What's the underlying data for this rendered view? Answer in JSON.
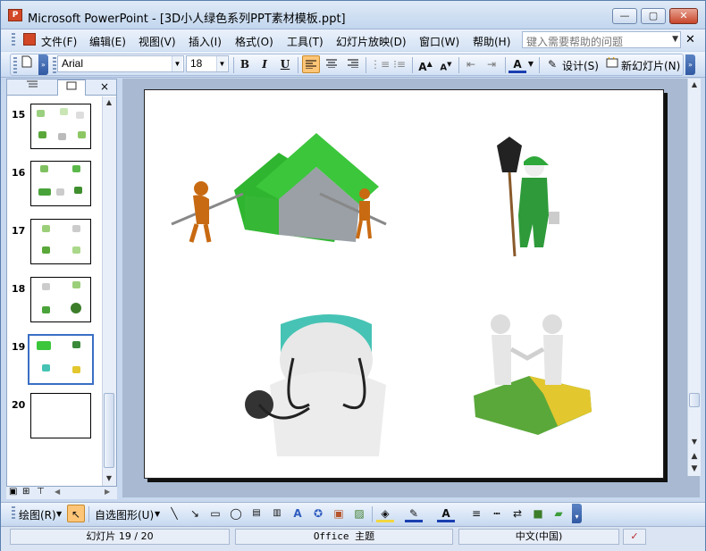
{
  "window": {
    "app_icon": "P",
    "title": "Microsoft PowerPoint - [3D小人绿色系列PPT素材模板.ppt]",
    "minimize": "—",
    "maximize": "▢",
    "close": "✕"
  },
  "menubar": {
    "items": [
      "文件(F)",
      "编辑(E)",
      "视图(V)",
      "插入(I)",
      "格式(O)",
      "工具(T)",
      "幻灯片放映(D)",
      "窗口(W)",
      "帮助(H)"
    ],
    "help_placeholder": "键入需要帮助的问题",
    "doc_close": "✕"
  },
  "toolbar": {
    "font": "Arial",
    "size": "18",
    "bold": "B",
    "italic": "I",
    "underline": "U",
    "design_label": "设计(S)",
    "new_slide_label": "新幻灯片(N)"
  },
  "slides_pane": {
    "close": "×",
    "slides": [
      {
        "num": "15"
      },
      {
        "num": "16"
      },
      {
        "num": "17"
      },
      {
        "num": "18"
      },
      {
        "num": "19",
        "selected": true
      },
      {
        "num": "20"
      }
    ]
  },
  "drawing_toolbar": {
    "draw_label": "绘图(R)",
    "autoshapes_label": "自选图形(U)"
  },
  "statusbar": {
    "slide_info": "幻灯片 19 / 20",
    "theme": "Office 主题",
    "language": "中文(中国)"
  },
  "colors": {
    "house_green": "#3cc63c",
    "figure_orange": "#c86a12",
    "cap_teal": "#46c3b4",
    "puzzle_green": "#5aa83a",
    "puzzle_yellow": "#e2c72f"
  }
}
